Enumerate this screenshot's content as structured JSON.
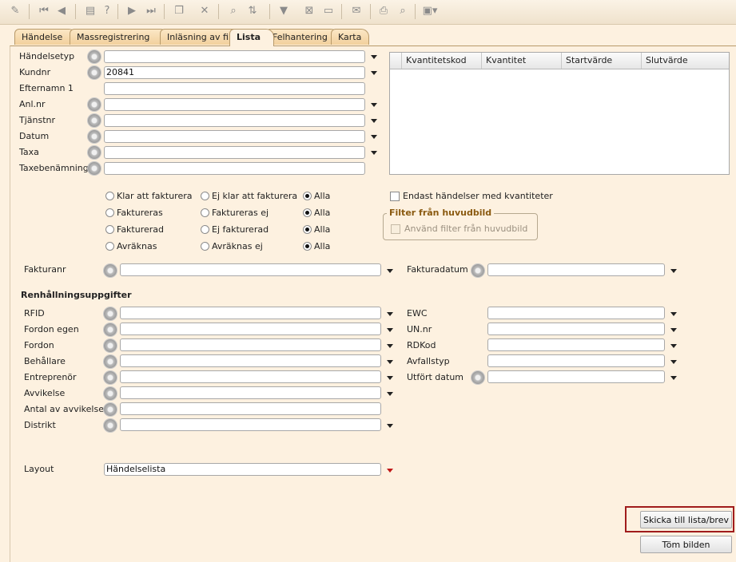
{
  "toolbar": {
    "icons": [
      "wizard-icon",
      "first-icon",
      "prev-icon",
      "doc-icon",
      "help-icon",
      "next-icon",
      "last-icon",
      "copy-icon",
      "delete-icon",
      "find-icon",
      "sort-icon",
      "filter-icon",
      "clear-filter-icon",
      "message-icon",
      "mail-icon",
      "print-icon",
      "preview-icon",
      "export-icon"
    ],
    "help_glyph": "?"
  },
  "tabs": [
    {
      "label": "Händelse"
    },
    {
      "label": "Massregistrering"
    },
    {
      "label": "Inläsning av fil"
    },
    {
      "label": "Lista"
    },
    {
      "label": "Felhantering"
    },
    {
      "label": "Karta"
    }
  ],
  "fields": {
    "handelsetyp": {
      "label": "Händelsetyp",
      "value": ""
    },
    "kundnr": {
      "label": "Kundnr",
      "value": "20841"
    },
    "efternamn": {
      "label": "Efternamn 1",
      "value": ""
    },
    "anlnr": {
      "label": "Anl.nr",
      "value": ""
    },
    "tjanstnr": {
      "label": "Tjänstnr",
      "value": ""
    },
    "datum": {
      "label": "Datum",
      "value": ""
    },
    "taxa": {
      "label": "Taxa",
      "value": ""
    },
    "taxebenamning": {
      "label": "Taxebenämning",
      "value": ""
    }
  },
  "grid": {
    "columns": [
      "Kvantitetskod",
      "Kvantitet",
      "Startvärde",
      "Slutvärde"
    ]
  },
  "radios": [
    [
      "Klar att fakturera",
      "Ej klar att fakturera",
      "Alla"
    ],
    [
      "Faktureras",
      "Faktureras ej",
      "Alla"
    ],
    [
      "Fakturerad",
      "Ej fakturerad",
      "Alla"
    ],
    [
      "Avräknas",
      "Avräknas ej",
      "Alla"
    ]
  ],
  "options": {
    "endast_label": "Endast händelser med kvantiteter",
    "filter_group_title": "Filter från huvudbild",
    "anvand_filter_label": "Använd filter från huvudbild"
  },
  "faktura": {
    "fakturanr_label": "Fakturanr",
    "fakturadatum_label": "Fakturadatum"
  },
  "renhallning": {
    "title": "Renhållningsuppgifter",
    "left": [
      "RFID",
      "Fordon egen",
      "Fordon",
      "Behållare",
      "Entreprenör",
      "Avvikelse",
      "Antal av avvikelse",
      "Distrikt"
    ],
    "right": [
      "EWC",
      "UN.nr",
      "RDKod",
      "Avfallstyp",
      "Utfört datum"
    ]
  },
  "layout": {
    "label": "Layout",
    "value": "Händelselista"
  },
  "buttons": {
    "send": "Skicka till lista/brev",
    "clear": "Töm bilden"
  }
}
